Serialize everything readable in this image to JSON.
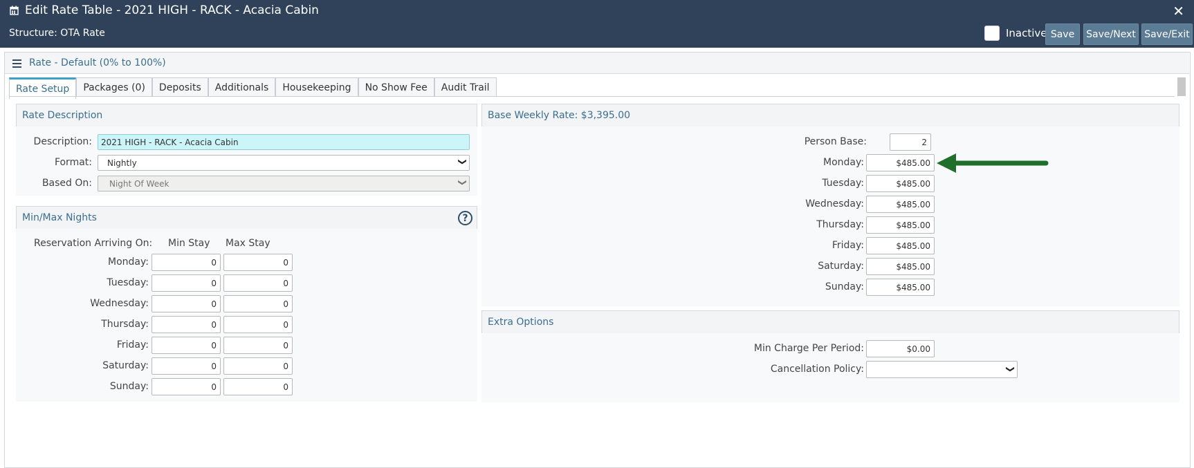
{
  "header": {
    "title": "Edit Rate Table - 2021 HIGH - RACK - Acacia Cabin",
    "structure": "Structure: OTA Rate",
    "inactive_label": "Inactive",
    "save_label": "Save",
    "save_next_label": "Save/Next",
    "save_exit_label": "Save/Exit",
    "close_glyph": "✕"
  },
  "rate_bar": {
    "label": "Rate - Default (0% to 100%)"
  },
  "tabs": [
    {
      "label": "Rate Setup"
    },
    {
      "label": "Packages (0)"
    },
    {
      "label": "Deposits"
    },
    {
      "label": "Additionals"
    },
    {
      "label": "Housekeeping"
    },
    {
      "label": "No Show Fee"
    },
    {
      "label": "Audit Trail"
    }
  ],
  "rate_description": {
    "heading": "Rate Description",
    "description_label": "Description:",
    "description_value": "2021 HIGH - RACK - Acacia Cabin",
    "format_label": "Format:",
    "format_value": "Nightly",
    "based_on_label": "Based On:",
    "based_on_value": "Night Of Week"
  },
  "min_max": {
    "heading": "Min/Max Nights",
    "arriving_label": "Reservation Arriving On:",
    "min_header": "Min Stay",
    "max_header": "Max Stay",
    "rows": [
      {
        "day": "Monday:",
        "min": "0",
        "max": "0"
      },
      {
        "day": "Tuesday:",
        "min": "0",
        "max": "0"
      },
      {
        "day": "Wednesday:",
        "min": "0",
        "max": "0"
      },
      {
        "day": "Thursday:",
        "min": "0",
        "max": "0"
      },
      {
        "day": "Friday:",
        "min": "0",
        "max": "0"
      },
      {
        "day": "Saturday:",
        "min": "0",
        "max": "0"
      },
      {
        "day": "Sunday:",
        "min": "0",
        "max": "0"
      }
    ]
  },
  "base_weekly": {
    "heading": "Base Weekly Rate: $3,395.00",
    "person_base_label": "Person Base:",
    "person_base_value": "2",
    "rows": [
      {
        "day": "Monday:",
        "value": "$485.00"
      },
      {
        "day": "Tuesday:",
        "value": "$485.00"
      },
      {
        "day": "Wednesday:",
        "value": "$485.00"
      },
      {
        "day": "Thursday:",
        "value": "$485.00"
      },
      {
        "day": "Friday:",
        "value": "$485.00"
      },
      {
        "day": "Saturday:",
        "value": "$485.00"
      },
      {
        "day": "Sunday:",
        "value": "$485.00"
      }
    ]
  },
  "extra_options": {
    "heading": "Extra Options",
    "min_charge_label": "Min Charge Per Period:",
    "min_charge_value": "$0.00",
    "cancellation_label": "Cancellation Policy:",
    "cancellation_value": ""
  },
  "colors": {
    "header_bg": "#30425a",
    "button_bg": "#5b7c94",
    "accent_text": "#3b6e8f",
    "arrow": "#1f6e2a",
    "description_bg": "#ccf5f9"
  }
}
